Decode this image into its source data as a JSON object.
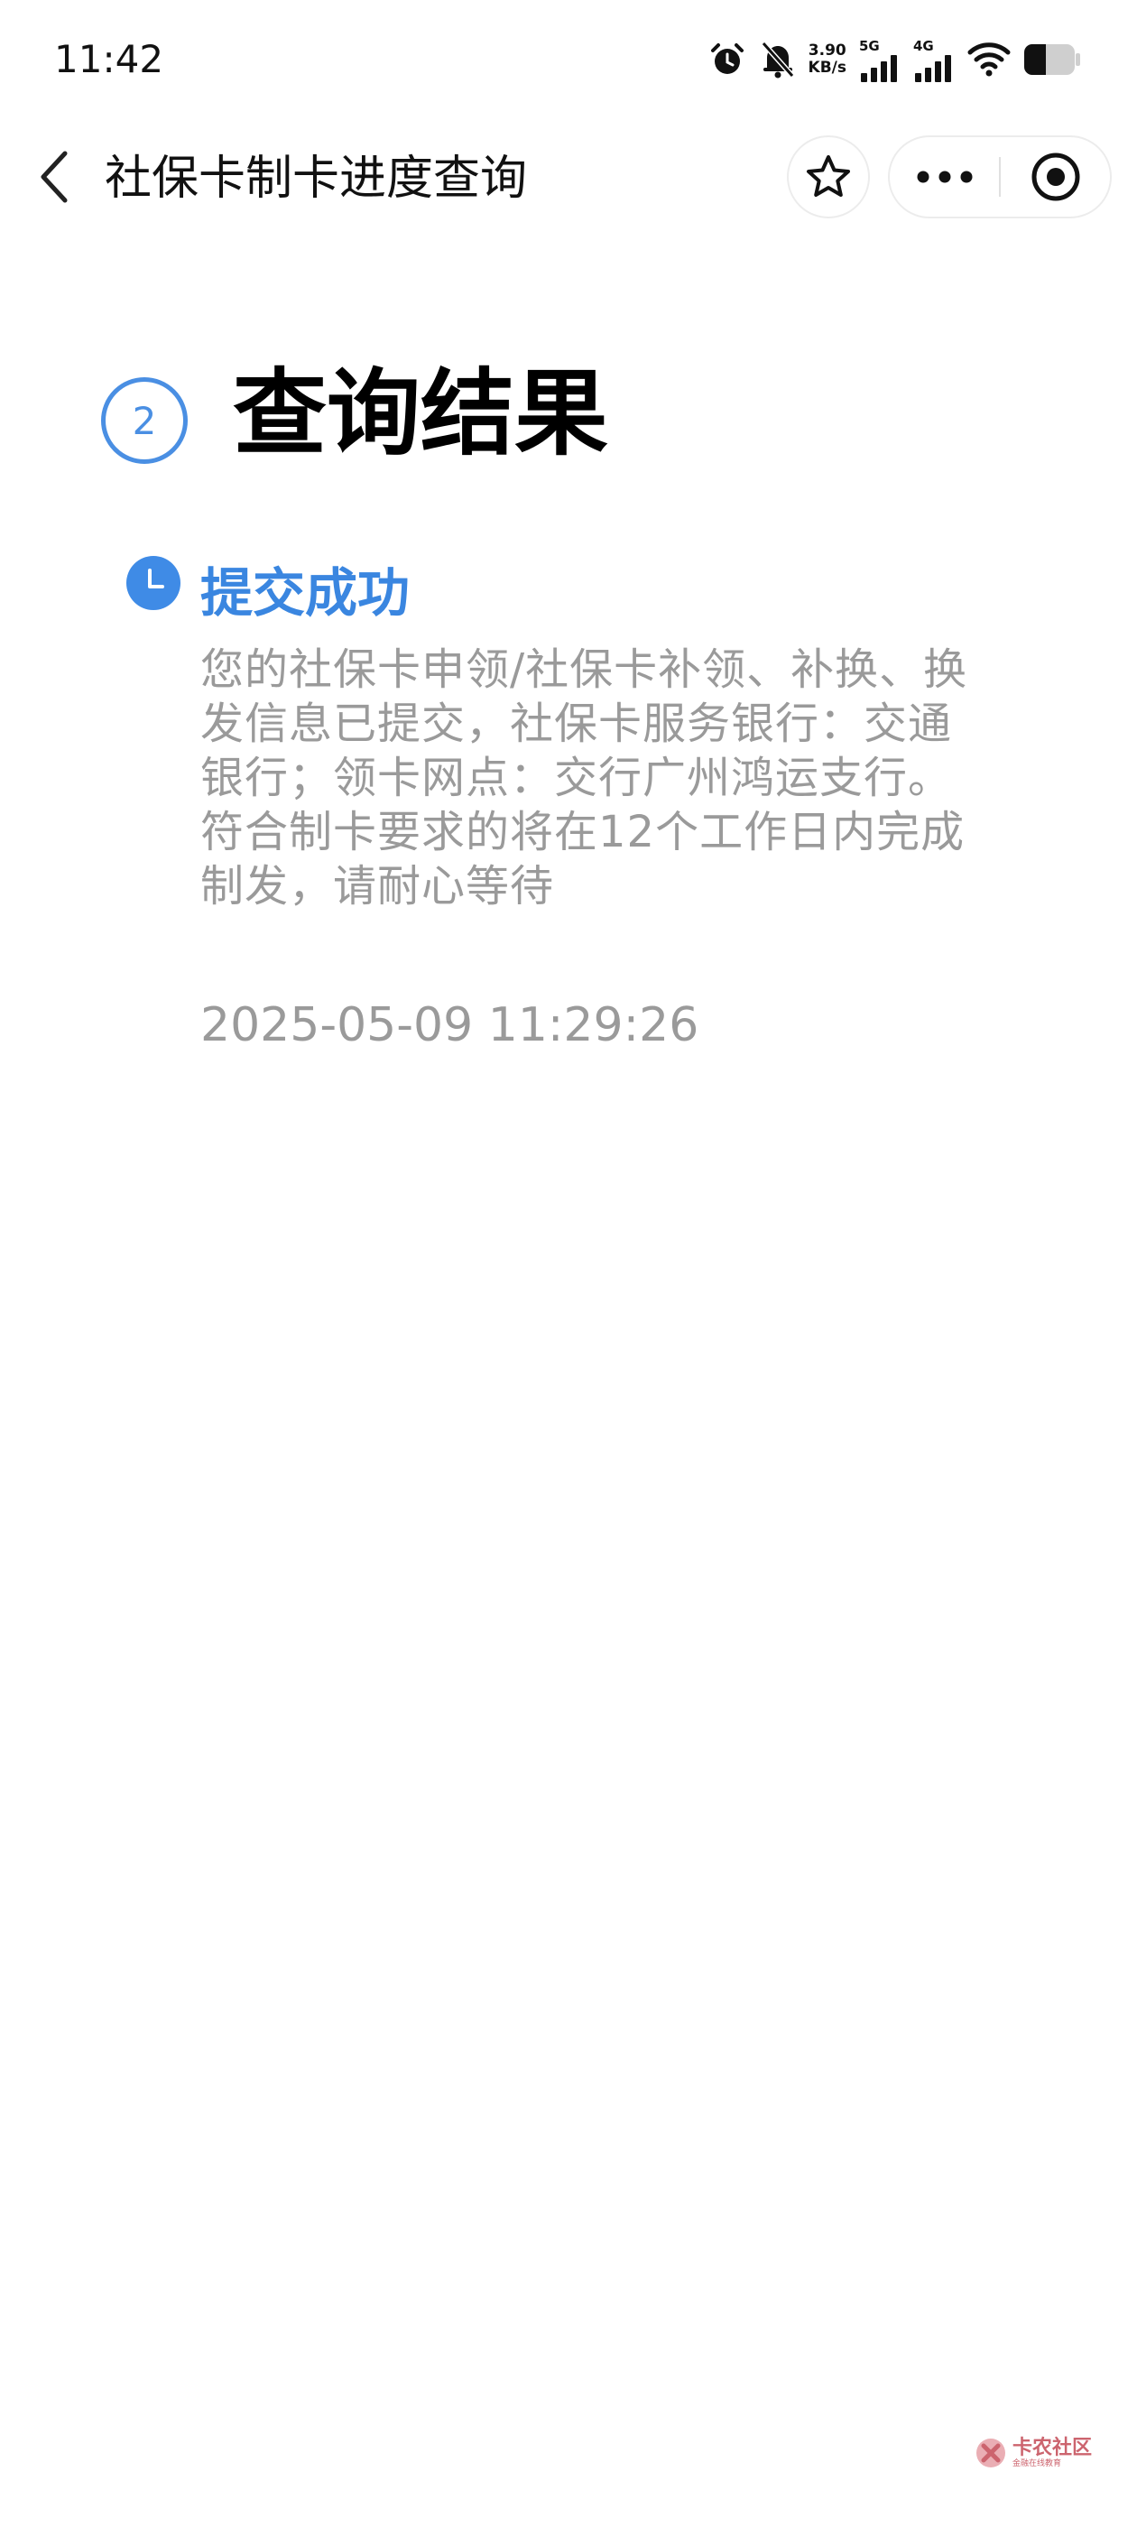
{
  "status_bar": {
    "time": "11:42",
    "speed_value": "3.90",
    "speed_unit": "KB/s",
    "net1": "5G",
    "net2": "4G",
    "icons": [
      "alarm-icon",
      "mute-bell-icon",
      "signal-icon",
      "wifi-icon",
      "battery-icon"
    ]
  },
  "nav": {
    "title": "社保卡制卡进度查询",
    "icons": [
      "back-arrow-icon",
      "star-icon",
      "more-icon",
      "target-icon"
    ]
  },
  "result": {
    "step_number": "2",
    "heading": "查询结果",
    "status_title": "提交成功",
    "status_desc": "您的社保卡申领/社保卡补领、补换、换发信息已提交，社保卡服务银行：交通银行；领卡网点：交行广州鸿运支行。符合制卡要求的将在12个工作日内完成制发，请耐心等待",
    "timestamp": "2025-05-09 11:29:26"
  },
  "watermark": {
    "name": "卡农社区",
    "tagline": "金融在线教育"
  },
  "colors": {
    "accent": "#3f8be6",
    "muted_text": "#9a9a9a",
    "watermark": "#c44a55"
  }
}
